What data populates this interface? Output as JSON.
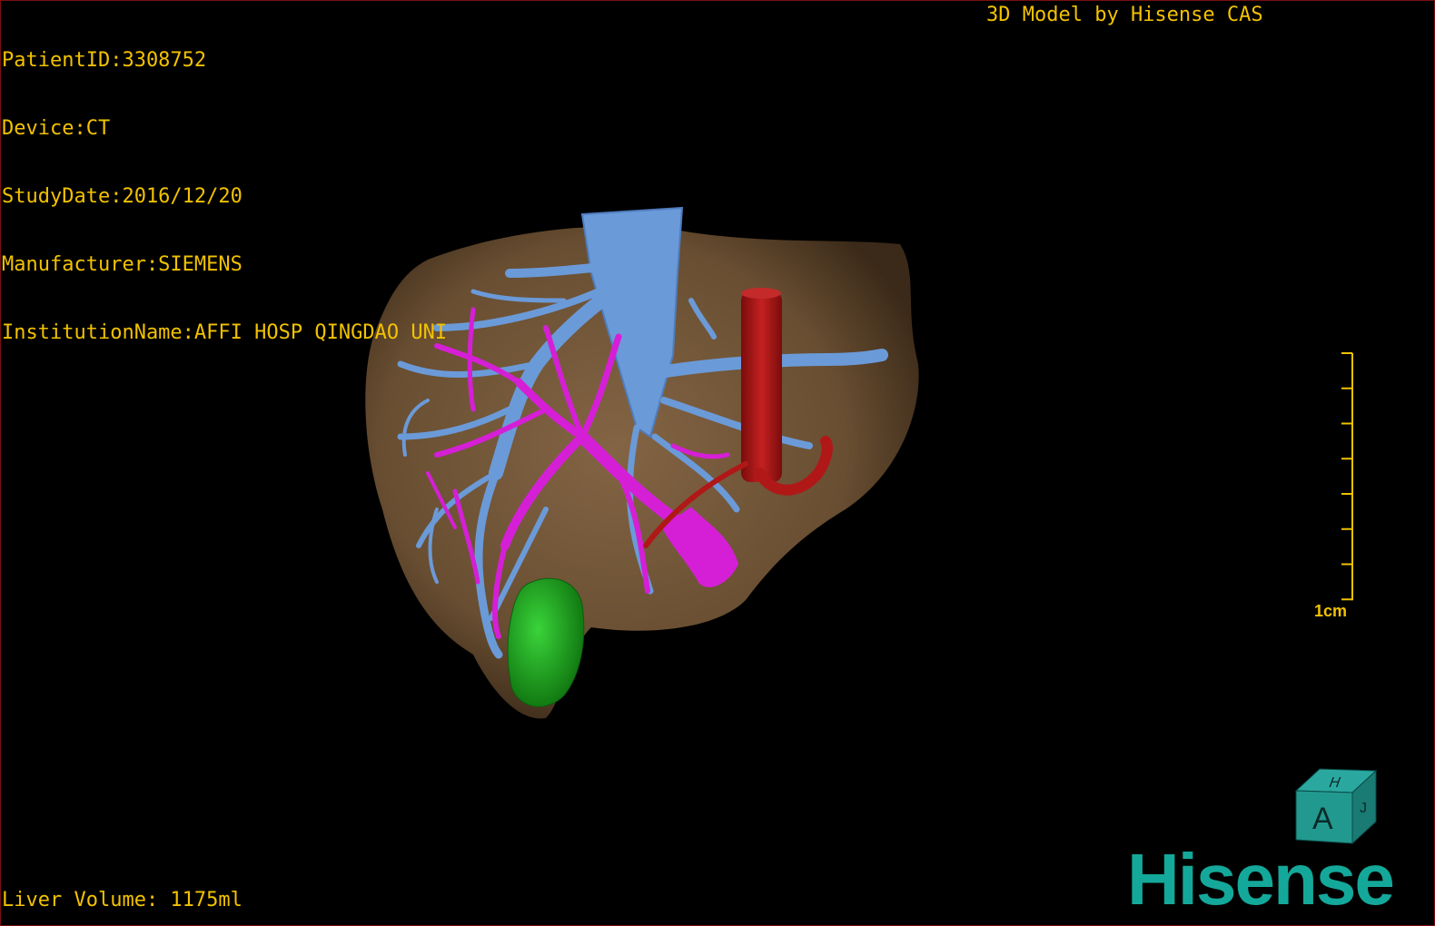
{
  "patient_info": {
    "patient_id": "PatientID:3308752",
    "device": "Device:CT",
    "study_date": "StudyDate:2016/12/20",
    "manufacturer": "Manufacturer:SIEMENS",
    "institution": "InstitutionName:AFFI HOSP QINGDAO UNI"
  },
  "header": {
    "title": "3D Model by Hisense CAS"
  },
  "footer": {
    "liver_volume": "Liver Volume: 1175ml"
  },
  "scale": {
    "label": "1cm",
    "ticks": 8
  },
  "orientation_cube": {
    "front_label": "A",
    "top_label": "H",
    "side_label": "J"
  },
  "brand": {
    "logo_text": "Hisense",
    "color": "#14a89a"
  },
  "colors": {
    "overlay_text": "#f2c200",
    "liver": "#7a5a3a",
    "hepatic_vein": "#6b9ad8",
    "portal_vein": "#d51fd6",
    "artery": "#b01818",
    "tumor": "#1fae1f",
    "border": "#7a1010"
  },
  "structures": [
    "liver",
    "hepatic-vein",
    "portal-vein",
    "artery",
    "tumor"
  ]
}
